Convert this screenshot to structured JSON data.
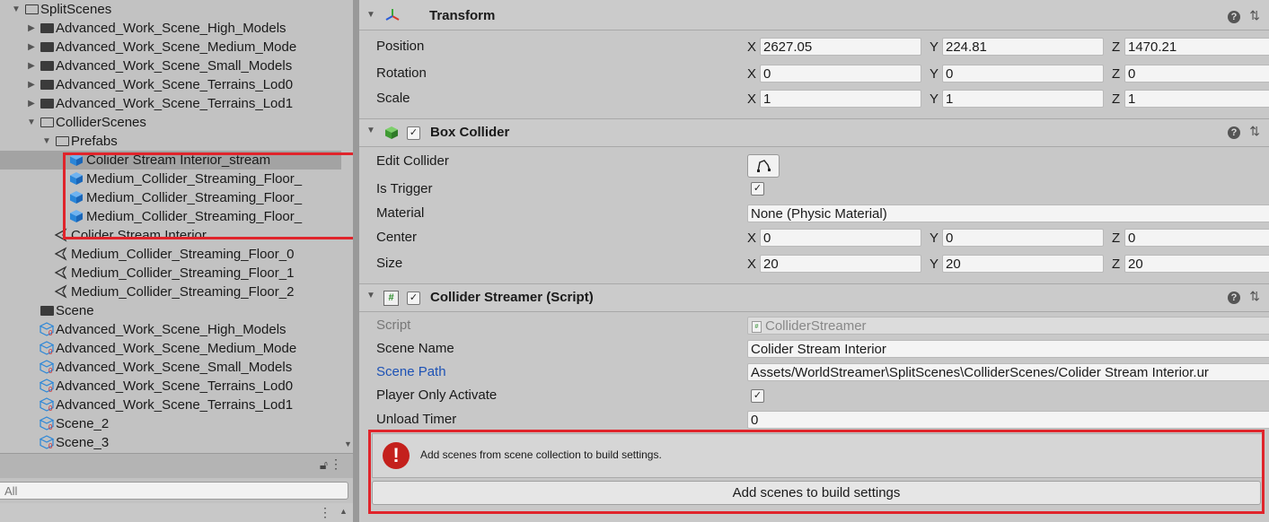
{
  "project": {
    "tree": [
      {
        "label": "SplitScenes",
        "icon": "folder-open-icon",
        "indent": 0,
        "expanded": true
      },
      {
        "label": "Advanced_Work_Scene_High_Models",
        "icon": "folder-icon",
        "indent": 1,
        "expanded": false
      },
      {
        "label": "Advanced_Work_Scene_Medium_Mode",
        "icon": "folder-icon",
        "indent": 1,
        "expanded": false
      },
      {
        "label": "Advanced_Work_Scene_Small_Models",
        "icon": "folder-icon",
        "indent": 1,
        "expanded": false
      },
      {
        "label": "Advanced_Work_Scene_Terrains_Lod0",
        "icon": "folder-icon",
        "indent": 1,
        "expanded": false
      },
      {
        "label": "Advanced_Work_Scene_Terrains_Lod1",
        "icon": "folder-icon",
        "indent": 1,
        "expanded": false
      },
      {
        "label": "ColliderScenes",
        "icon": "folder-open-icon",
        "indent": 1,
        "expanded": true
      },
      {
        "label": "Prefabs",
        "icon": "folder-open-icon",
        "indent": 2,
        "expanded": true
      },
      {
        "label": "Colider Stream Interior_stream",
        "icon": "prefab-cube-icon",
        "indent": 3,
        "selected": true
      },
      {
        "label": "Medium_Collider_Streaming_Floor_",
        "icon": "prefab-cube-icon",
        "indent": 3
      },
      {
        "label": "Medium_Collider_Streaming_Floor_",
        "icon": "prefab-cube-icon",
        "indent": 3
      },
      {
        "label": "Medium_Collider_Streaming_Floor_",
        "icon": "prefab-cube-icon",
        "indent": 3
      },
      {
        "label": "Colider Stream Interior",
        "icon": "unity-scene-icon",
        "indent": 2
      },
      {
        "label": "Medium_Collider_Streaming_Floor_0",
        "icon": "unity-scene-icon",
        "indent": 2
      },
      {
        "label": "Medium_Collider_Streaming_Floor_1",
        "icon": "unity-scene-icon",
        "indent": 2
      },
      {
        "label": "Medium_Collider_Streaming_Floor_2",
        "icon": "unity-scene-icon",
        "indent": 2
      },
      {
        "label": "Scene",
        "icon": "folder-icon",
        "indent": 1
      },
      {
        "label": "Advanced_Work_Scene_High_Models",
        "icon": "scene-collection-icon",
        "indent": 1
      },
      {
        "label": "Advanced_Work_Scene_Medium_Mode",
        "icon": "scene-collection-icon",
        "indent": 1
      },
      {
        "label": "Advanced_Work_Scene_Small_Models",
        "icon": "scene-collection-icon",
        "indent": 1
      },
      {
        "label": "Advanced_Work_Scene_Terrains_Lod0",
        "icon": "scene-collection-icon",
        "indent": 1
      },
      {
        "label": "Advanced_Work_Scene_Terrains_Lod1",
        "icon": "scene-collection-icon",
        "indent": 1
      },
      {
        "label": "Scene_2",
        "icon": "scene-collection-icon",
        "indent": 1
      },
      {
        "label": "Scene_3",
        "icon": "scene-collection-icon",
        "indent": 1
      }
    ],
    "search_value": "All"
  },
  "transform": {
    "title": "Transform",
    "position_label": "Position",
    "rotation_label": "Rotation",
    "scale_label": "Scale",
    "pos": {
      "x": "2627.05",
      "y": "224.81",
      "z": "1470.21"
    },
    "rot": {
      "x": "0",
      "y": "0",
      "z": "0"
    },
    "scl": {
      "x": "1",
      "y": "1",
      "z": "1"
    }
  },
  "box_collider": {
    "title": "Box Collider",
    "edit_collider_label": "Edit Collider",
    "is_trigger_label": "Is Trigger",
    "material_label": "Material",
    "material_value": "None (Physic Material)",
    "center_label": "Center",
    "size_label": "Size",
    "center": {
      "x": "0",
      "y": "0",
      "z": "0"
    },
    "size": {
      "x": "20",
      "y": "20",
      "z": "20"
    }
  },
  "streamer": {
    "title": "Collider Streamer (Script)",
    "script_label": "Script",
    "script_value": "ColliderStreamer",
    "scene_name_label": "Scene Name",
    "scene_name_value": "Colider Stream Interior",
    "scene_path_label": "Scene Path",
    "scene_path_value": "Assets/WorldStreamer\\SplitScenes\\ColliderScenes/Colider Stream Interior.ur",
    "player_only_label": "Player Only Activate",
    "unload_timer_label": "Unload Timer",
    "unload_timer_value": "0",
    "help_text": "Add scenes from scene collection to build settings.",
    "build_button": "Add scenes to build settings"
  },
  "axes": {
    "x": "X",
    "y": "Y",
    "z": "Z"
  },
  "colors": {
    "highlight_box": "#e0242b",
    "error": "#c4201c",
    "link_blue": "#1d52b5"
  }
}
